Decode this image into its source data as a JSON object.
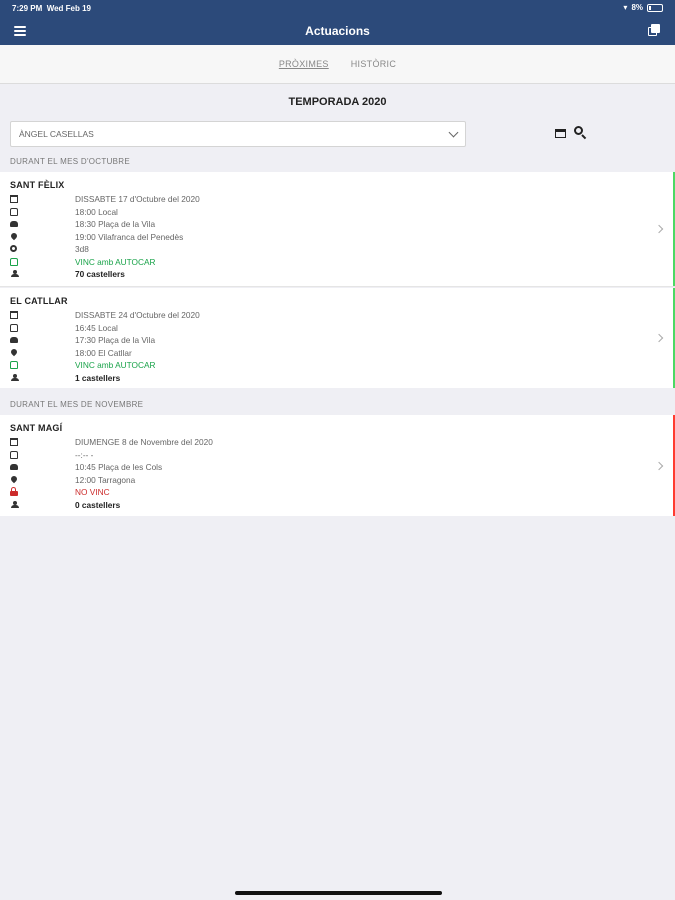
{
  "status_bar": {
    "time": "7:29 PM",
    "date": "Wed Feb 19",
    "battery": "8%"
  },
  "header": {
    "title": "Actuacions",
    "menu_icon": "hamburger-icon",
    "action_icon": "copy-icon"
  },
  "tabs": [
    {
      "label": "PRÒXIMES",
      "active": true
    },
    {
      "label": "HISTÒRIC",
      "active": false
    }
  ],
  "season": "TEMPORADA 2020",
  "filter": {
    "selected": "ÀNGEL CASELLAS"
  },
  "sections": [
    {
      "header": "DURANT EL MES D'OCTUBRE",
      "events": [
        {
          "name": "SANT FÈLIX",
          "status_color": "#4cd964",
          "rows": [
            {
              "icon": "calendar-icon",
              "text": "DISSABTE 17 d'Octubre del 2020"
            },
            {
              "icon": "bus-icon",
              "text": "18:00 Local"
            },
            {
              "icon": "car-icon",
              "text": "18:30 Plaça de la Vila"
            },
            {
              "icon": "location-pin-icon",
              "text": "19:00 Vilafranca del Penedès"
            },
            {
              "icon": "castell-icon",
              "text": "3d8"
            },
            {
              "icon": "bus-icon",
              "text": "VINC amb AUTOCAR",
              "style": "green"
            },
            {
              "icon": "group-icon",
              "text": "70 castellers",
              "style": "bold"
            }
          ]
        },
        {
          "name": "EL CATLLAR",
          "status_color": "#4cd964",
          "rows": [
            {
              "icon": "calendar-icon",
              "text": "DISSABTE 24 d'Octubre del 2020"
            },
            {
              "icon": "bus-icon",
              "text": "16:45 Local"
            },
            {
              "icon": "car-icon",
              "text": "17:30 Plaça de la Vila"
            },
            {
              "icon": "location-pin-icon",
              "text": "18:00 El Catllar"
            },
            {
              "icon": "bus-icon",
              "text": "VINC amb AUTOCAR",
              "style": "green"
            },
            {
              "icon": "group-icon",
              "text": "1 castellers",
              "style": "bold"
            }
          ]
        }
      ]
    },
    {
      "header": "DURANT EL MES DE NOVEMBRE",
      "events": [
        {
          "name": "SANT MAGÍ",
          "status_color": "#ff3b30",
          "rows": [
            {
              "icon": "calendar-icon",
              "text": "DIUMENGE 8 de Novembre del 2020"
            },
            {
              "icon": "bus-icon",
              "text": "--:-- -"
            },
            {
              "icon": "car-icon",
              "text": "10:45 Plaça de les Cols"
            },
            {
              "icon": "location-pin-icon",
              "text": "12:00 Tarragona"
            },
            {
              "icon": "lock-icon",
              "text": "NO VINC",
              "style": "red"
            },
            {
              "icon": "group-icon",
              "text": "0 castellers",
              "style": "bold"
            }
          ]
        }
      ]
    }
  ]
}
